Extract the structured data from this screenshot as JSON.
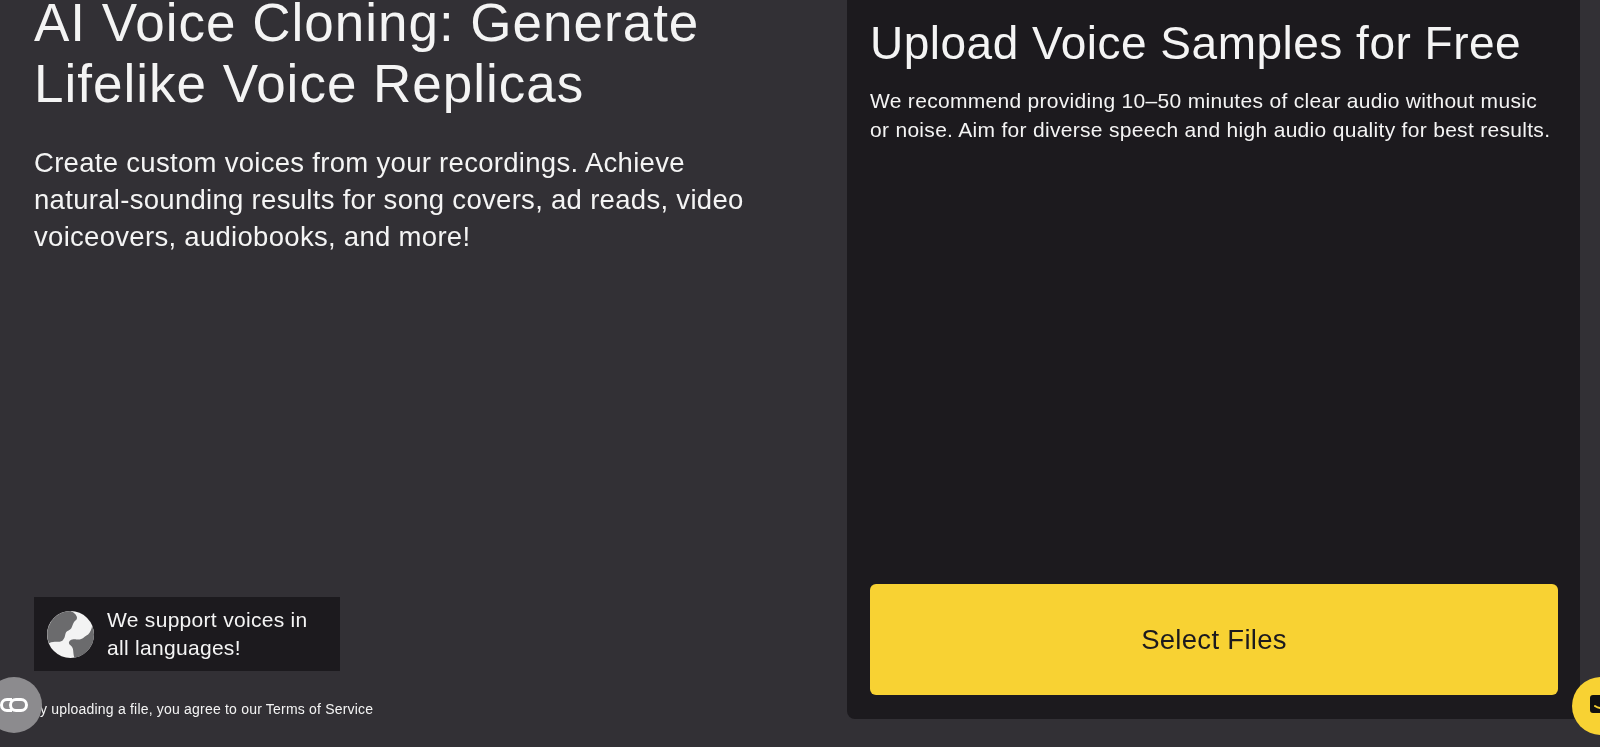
{
  "hero": {
    "title": "AI Voice Cloning: Generate Lifelike Voice Replicas",
    "subtitle": "Create custom voices from your recordings. Achieve natural-sounding results for song covers, ad reads, video voiceovers, audiobooks, and more!"
  },
  "languages_badge": {
    "text": "We support voices in all languages!"
  },
  "terms_notice": "y uploading a file, you agree to our Terms of Service",
  "upload_panel": {
    "title": "Upload Voice Samples for Free",
    "description": "We recommend providing 10–50 minutes of clear audio without music or noise. Aim for diverse speech and high audio quality for best results.",
    "button": "Select Files"
  }
}
